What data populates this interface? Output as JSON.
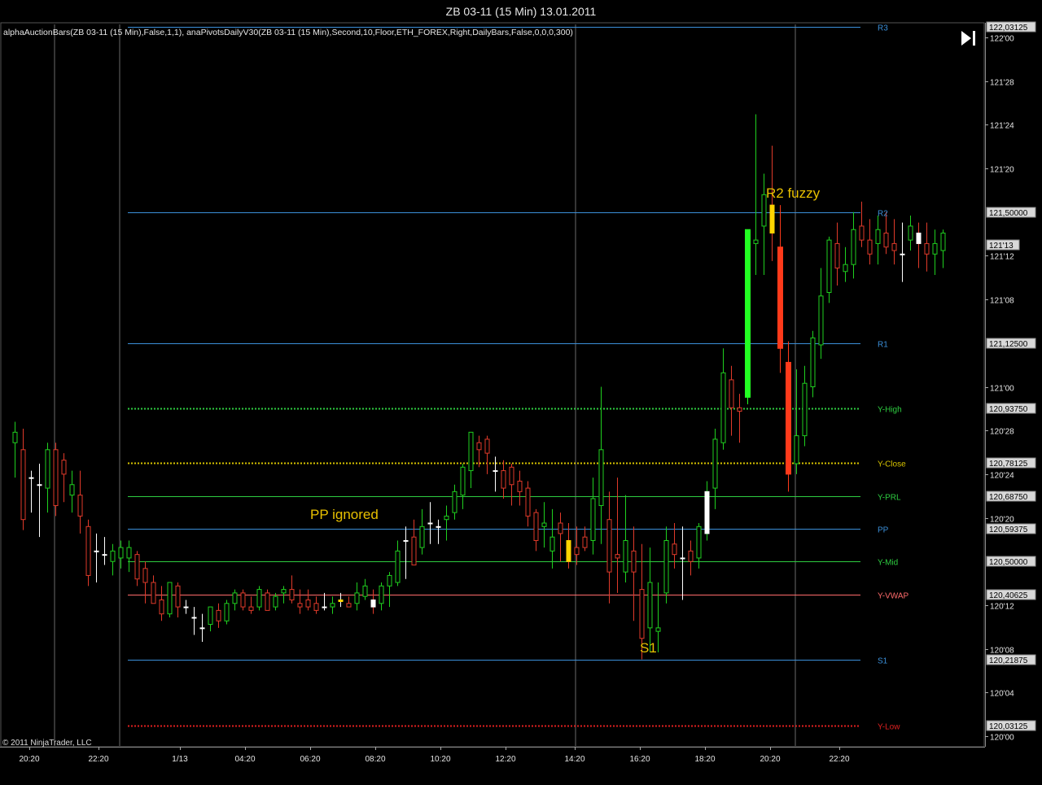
{
  "window": {
    "title": "ZB 03-11 (15 Min)  13.01.2011"
  },
  "indicator_text": "alphaAuctionBars(ZB 03-11 (15 Min),False,1,1),  anaPivotsDailyV30(ZB 03-11 (15 Min),Second,10,Floor,ETH_FOREX,Right,DailyBars,False,0,0,0,300)",
  "copyright": "© 2011 NinjaTrader, LLC",
  "icons": {
    "play_end": "skip-to-end-icon"
  },
  "colors": {
    "background": "#000000",
    "up_candle": "#1fd01f",
    "down_candle": "#e03a2a",
    "doji": "#ffffff",
    "wide_up": "#22ff22",
    "wide_down": "#ff3a1a",
    "pivot_blue": "#3b8fd9",
    "green_level": "#2ecc40",
    "yellow_level": "#d8c400",
    "red_level": "#e02020",
    "vwap": "#ff6b6b",
    "annotation": "#e8c000"
  },
  "chart_data": {
    "type": "candlestick",
    "symbol": "ZB 03-11",
    "interval": "15 Min",
    "date": "13.01.2011",
    "y_axis": {
      "min": 120.0,
      "max": 122.04,
      "price_format": "32nds",
      "tick_labels": [
        "122'00",
        "121'28",
        "121'24",
        "121'20",
        "121'12",
        "121'08",
        "121'00",
        "120'28",
        "120'24",
        "120'20",
        "120'12",
        "120'08",
        "120'04",
        "120'00"
      ],
      "tick_values": [
        122.0,
        121.875,
        121.75,
        121.625,
        121.375,
        121.25,
        121.0,
        120.875,
        120.75,
        120.625,
        120.375,
        120.25,
        120.125,
        120.0
      ]
    },
    "x_axis": {
      "tick_labels": [
        "20:20",
        "22:20",
        "1/13",
        "04:20",
        "06:20",
        "08:20",
        "10:20",
        "12:20",
        "14:20",
        "16:20",
        "18:20",
        "20:20",
        "22:20"
      ]
    },
    "levels": [
      {
        "name": "R3",
        "price": 122.03125,
        "label": "122,03125",
        "color": "#3b8fd9",
        "style": "solid"
      },
      {
        "name": "R2",
        "price": 121.5,
        "label": "121,50000",
        "color": "#3b8fd9",
        "style": "solid"
      },
      {
        "name": "R1",
        "price": 121.125,
        "label": "121,12500",
        "color": "#3b8fd9",
        "style": "solid"
      },
      {
        "name": "Y-High",
        "price": 120.9375,
        "label": "120,93750",
        "color": "#2ecc40",
        "style": "dotted"
      },
      {
        "name": "Y-Close",
        "price": 120.78125,
        "label": "120,78125",
        "color": "#d8c400",
        "style": "dotted"
      },
      {
        "name": "Y-PRL",
        "price": 120.6875,
        "label": "120,68750",
        "color": "#2ecc40",
        "style": "solid"
      },
      {
        "name": "PP",
        "price": 120.59375,
        "label": "120,59375",
        "color": "#3b8fd9",
        "style": "solid"
      },
      {
        "name": "Y-Mid",
        "price": 120.5,
        "label": "120,50000",
        "color": "#2ecc40",
        "style": "solid"
      },
      {
        "name": "Y-VWAP",
        "price": 120.40625,
        "label": "120,40625",
        "color": "#ff6b6b",
        "style": "solid"
      },
      {
        "name": "S1",
        "price": 120.21875,
        "label": "120,21875",
        "color": "#3b8fd9",
        "style": "solid"
      },
      {
        "name": "Y-Low",
        "price": 120.03125,
        "label": "120,03125",
        "color": "#e02020",
        "style": "dotted"
      }
    ],
    "current_price": {
      "label": "121'13",
      "value": 121.40625
    },
    "annotations": [
      {
        "text": "PP ignored",
        "price": 120.64,
        "bar": 12
      },
      {
        "text": "S1",
        "price": 120.23,
        "bar": 64
      },
      {
        "text": "R2 fuzzy",
        "price": 121.55,
        "bar": 92
      }
    ],
    "session_breaks": [
      4,
      11,
      55,
      88
    ],
    "candles_ohlc_note": "o,h,l,c per 15-min bar",
    "candles": [
      [
        120.84,
        120.9,
        120.74,
        120.87
      ],
      [
        120.82,
        120.88,
        120.59,
        120.62
      ],
      [
        120.74,
        120.76,
        120.64,
        120.74
      ],
      [
        120.72,
        120.78,
        120.57,
        120.72
      ],
      [
        120.71,
        120.84,
        120.64,
        120.82
      ],
      [
        120.82,
        120.84,
        120.63,
        120.66
      ],
      [
        120.79,
        120.81,
        120.67,
        120.75
      ],
      [
        120.69,
        120.76,
        120.64,
        120.72
      ],
      [
        120.69,
        120.76,
        120.58,
        120.63
      ],
      [
        120.6,
        120.62,
        120.43,
        120.46
      ],
      [
        120.53,
        120.58,
        120.44,
        120.53
      ],
      [
        120.52,
        120.57,
        120.49,
        120.52
      ],
      [
        120.5,
        120.55,
        120.46,
        120.53
      ],
      [
        120.51,
        120.56,
        120.48,
        120.54
      ],
      [
        120.51,
        120.56,
        120.47,
        120.54
      ],
      [
        120.52,
        120.53,
        120.43,
        120.45
      ],
      [
        120.48,
        120.5,
        120.38,
        120.44
      ],
      [
        120.44,
        120.46,
        120.38,
        120.38
      ],
      [
        120.39,
        120.43,
        120.33,
        120.35
      ],
      [
        120.35,
        120.44,
        120.34,
        120.44
      ],
      [
        120.43,
        120.44,
        120.34,
        120.37
      ],
      [
        120.37,
        120.39,
        120.35,
        120.37
      ],
      [
        120.34,
        120.37,
        120.29,
        120.34
      ],
      [
        120.31,
        120.35,
        120.27,
        120.31
      ],
      [
        120.32,
        120.37,
        120.3,
        120.37
      ],
      [
        120.36,
        120.38,
        120.31,
        120.33
      ],
      [
        120.33,
        120.39,
        120.32,
        120.38
      ],
      [
        120.38,
        120.42,
        120.36,
        120.41
      ],
      [
        120.41,
        120.42,
        120.36,
        120.37
      ],
      [
        120.37,
        120.4,
        120.35,
        120.36
      ],
      [
        120.37,
        120.43,
        120.36,
        120.42
      ],
      [
        120.41,
        120.42,
        120.36,
        120.36
      ],
      [
        120.37,
        120.41,
        120.36,
        120.4
      ],
      [
        120.41,
        120.43,
        120.38,
        120.42
      ],
      [
        120.42,
        120.46,
        120.38,
        120.39
      ],
      [
        120.38,
        120.42,
        120.35,
        120.37
      ],
      [
        120.39,
        120.42,
        120.36,
        120.37
      ],
      [
        120.38,
        120.4,
        120.35,
        120.36
      ],
      [
        120.37,
        120.41,
        120.36,
        120.37
      ],
      [
        120.37,
        120.4,
        120.35,
        120.38
      ],
      [
        120.39,
        120.41,
        120.37,
        120.39
      ],
      [
        120.38,
        120.4,
        120.37,
        120.37
      ],
      [
        120.38,
        120.44,
        120.36,
        120.41
      ],
      [
        120.4,
        120.45,
        120.39,
        120.43
      ],
      [
        120.39,
        120.42,
        120.35,
        120.37
      ],
      [
        120.38,
        120.44,
        120.36,
        120.43
      ],
      [
        120.43,
        120.47,
        120.37,
        120.46
      ],
      [
        120.44,
        120.56,
        120.43,
        120.53
      ],
      [
        120.56,
        120.6,
        120.45,
        120.56
      ],
      [
        120.57,
        120.62,
        120.49,
        120.49
      ],
      [
        120.54,
        120.65,
        120.52,
        120.6
      ],
      [
        120.61,
        120.67,
        120.55,
        120.61
      ],
      [
        120.6,
        120.62,
        120.55,
        120.6
      ],
      [
        120.62,
        120.66,
        120.56,
        120.63
      ],
      [
        120.64,
        120.72,
        120.62,
        120.7
      ],
      [
        120.69,
        120.78,
        120.65,
        120.77
      ],
      [
        120.76,
        120.86,
        120.71,
        120.87
      ],
      [
        120.84,
        120.86,
        120.77,
        120.82
      ],
      [
        120.85,
        120.86,
        120.75,
        120.81
      ],
      [
        120.76,
        120.8,
        120.7,
        120.76
      ],
      [
        120.76,
        120.79,
        120.68,
        120.71
      ],
      [
        120.77,
        120.78,
        120.66,
        120.72
      ],
      [
        120.73,
        120.76,
        120.66,
        120.7
      ],
      [
        120.71,
        120.73,
        120.6,
        120.63
      ],
      [
        120.64,
        120.65,
        120.53,
        120.56
      ],
      [
        120.6,
        120.67,
        120.54,
        120.61
      ],
      [
        120.53,
        120.65,
        120.48,
        120.57
      ],
      [
        120.61,
        120.64,
        120.5,
        120.58
      ],
      [
        120.56,
        120.61,
        120.48,
        120.5
      ],
      [
        120.54,
        120.6,
        120.49,
        120.52
      ],
      [
        120.57,
        120.6,
        120.53,
        120.54
      ],
      [
        120.56,
        120.74,
        120.52,
        120.68
      ],
      [
        120.66,
        121.0,
        120.55,
        120.82
      ],
      [
        120.62,
        120.7,
        120.38,
        120.47
      ],
      [
        120.52,
        120.74,
        120.41,
        120.51
      ],
      [
        120.47,
        120.69,
        120.44,
        120.56
      ],
      [
        120.53,
        120.6,
        120.33,
        120.47
      ],
      [
        120.42,
        120.55,
        120.22,
        120.28
      ],
      [
        120.31,
        120.54,
        120.24,
        120.44
      ],
      [
        120.3,
        120.44,
        120.24,
        120.31
      ],
      [
        120.41,
        120.6,
        120.38,
        120.56
      ],
      [
        120.55,
        120.61,
        120.48,
        120.52
      ],
      [
        120.51,
        120.6,
        120.39,
        120.51
      ],
      [
        120.53,
        120.56,
        120.46,
        120.5
      ],
      [
        120.51,
        120.61,
        120.48,
        120.6
      ],
      [
        120.58,
        120.73,
        120.56,
        120.7
      ],
      [
        120.71,
        120.88,
        120.65,
        120.85
      ],
      [
        120.84,
        121.11,
        120.82,
        121.04
      ],
      [
        121.02,
        121.06,
        120.86,
        120.94
      ],
      [
        120.94,
        120.98,
        120.84,
        120.93
      ],
      [
        120.97,
        121.45,
        120.95,
        121.45
      ],
      [
        121.41,
        121.78,
        121.32,
        121.42
      ],
      [
        121.46,
        121.61,
        121.32,
        121.55
      ],
      [
        121.52,
        121.69,
        121.36,
        121.44
      ],
      [
        121.4,
        121.52,
        121.04,
        121.11
      ],
      [
        121.07,
        121.13,
        120.7,
        120.75
      ],
      [
        120.78,
        121.05,
        120.75,
        120.86
      ],
      [
        120.86,
        121.06,
        120.83,
        121.01
      ],
      [
        121.0,
        121.16,
        120.97,
        121.14
      ],
      [
        121.12,
        121.34,
        121.08,
        121.26
      ],
      [
        121.27,
        121.43,
        121.24,
        121.42
      ],
      [
        121.41,
        121.47,
        121.29,
        121.34
      ],
      [
        121.33,
        121.4,
        121.3,
        121.35
      ],
      [
        121.35,
        121.5,
        121.31,
        121.45
      ],
      [
        121.46,
        121.53,
        121.4,
        121.42
      ],
      [
        121.42,
        121.48,
        121.35,
        121.38
      ],
      [
        121.41,
        121.49,
        121.35,
        121.45
      ],
      [
        121.44,
        121.5,
        121.38,
        121.4
      ],
      [
        121.41,
        121.48,
        121.35,
        121.39
      ],
      [
        121.38,
        121.47,
        121.3,
        121.38
      ],
      [
        121.42,
        121.49,
        121.39,
        121.46
      ],
      [
        121.44,
        121.47,
        121.34,
        121.41
      ],
      [
        121.41,
        121.47,
        121.33,
        121.38
      ],
      [
        121.38,
        121.45,
        121.32,
        121.41
      ],
      [
        121.39,
        121.45,
        121.34,
        121.44
      ]
    ]
  }
}
